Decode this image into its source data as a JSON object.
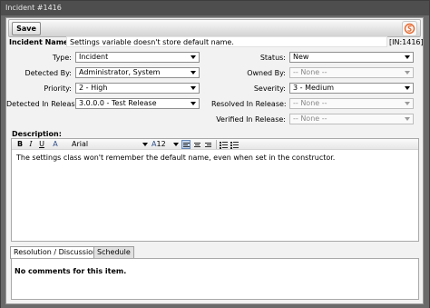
{
  "window": {
    "title": "Incident #1416"
  },
  "toolbar": {
    "save_label": "Save"
  },
  "incident": {
    "name_label": "Incident Name:",
    "name_value": "Settings variable doesn't store default name.",
    "id_tag": "[IN:1416]"
  },
  "fields": {
    "type": {
      "label": "Type:",
      "value": "Incident"
    },
    "detected_by": {
      "label": "Detected By:",
      "value": "Administrator, System"
    },
    "priority": {
      "label": "Priority:",
      "value": "2 - High"
    },
    "detected_in_release": {
      "label": "Detected In Release:",
      "value": "3.0.0.0 - Test Release"
    },
    "status": {
      "label": "Status:",
      "value": "New"
    },
    "owned_by": {
      "label": "Owned By:",
      "value": "-- None --"
    },
    "severity": {
      "label": "Severity:",
      "value": "3 - Medium"
    },
    "resolved_in_release": {
      "label": "Resolved In Release:",
      "value": "-- None --"
    },
    "verified_in_release": {
      "label": "Verified In Release:",
      "value": "-- None --"
    }
  },
  "description": {
    "label": "Description:",
    "text": "The settings class won't remember the default name, even when set in the constructor."
  },
  "editor_toolbar": {
    "bold": "B",
    "italic": "I",
    "underline": "U",
    "font_glyph": "A",
    "font": "Arial",
    "size_glyph": "A",
    "size": "12"
  },
  "tabs": [
    {
      "label": "Resolution / Discussion",
      "active": true
    },
    {
      "label": "Schedule",
      "active": false
    }
  ],
  "discussion": {
    "empty_text": "No comments for this item."
  },
  "colors": {
    "logo_accent": "#e8672a",
    "active_align": "#c4d6ee"
  }
}
